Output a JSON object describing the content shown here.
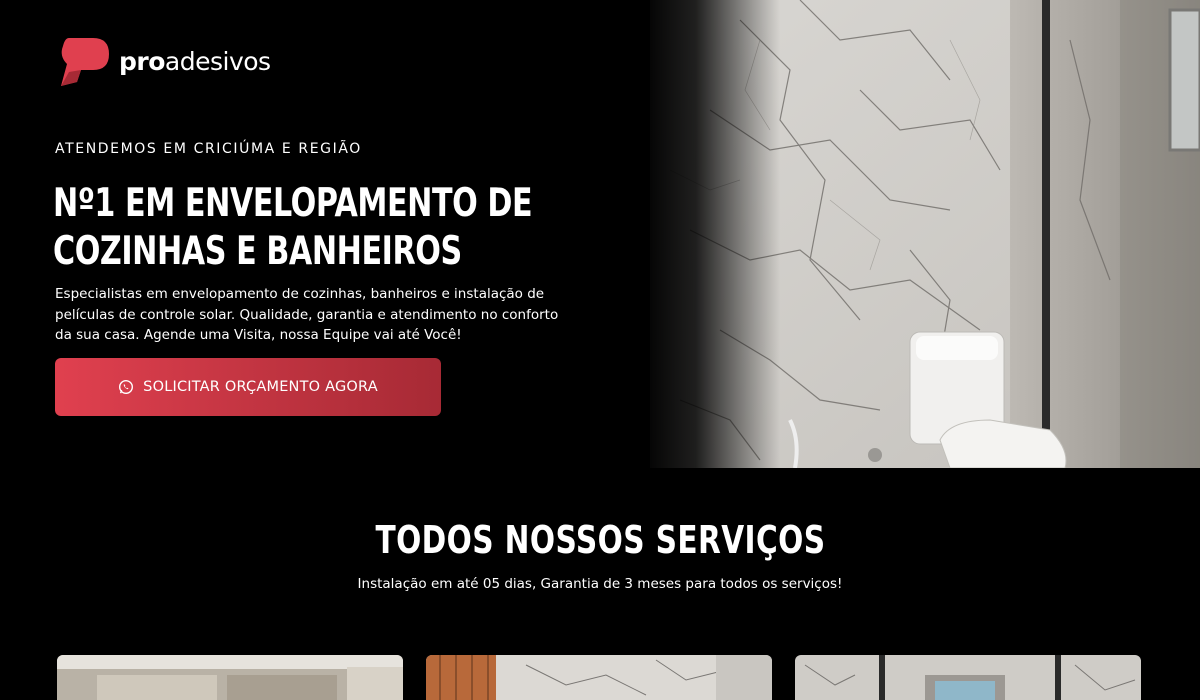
{
  "brand": {
    "name_bold": "pro",
    "name_light": "adesivos",
    "accent": "#e0404f"
  },
  "hero": {
    "eyebrow": "ATENDEMOS EM CRICIÚMA E REGIÃO",
    "headline_line1": "Nº1 EM ENVELOPAMENTO DE",
    "headline_line2": "COZINHAS E BANHEIROS",
    "lead": "Especialistas em envelopamento de cozinhas, banheiros e instalação de películas de controle solar. Qualidade, garantia e atendimento no conforto da sua casa. Agende uma Visita, nossa Equipe vai até Você!",
    "cta_label": "SOLICITAR ORÇAMENTO AGORA",
    "cta_icon": "whatsapp-icon"
  },
  "services": {
    "title": "TODOS NOSSOS SERVIÇOS",
    "subtitle": "Instalação em até 05 dias, Garantia de 3 meses para todos os serviços!"
  }
}
